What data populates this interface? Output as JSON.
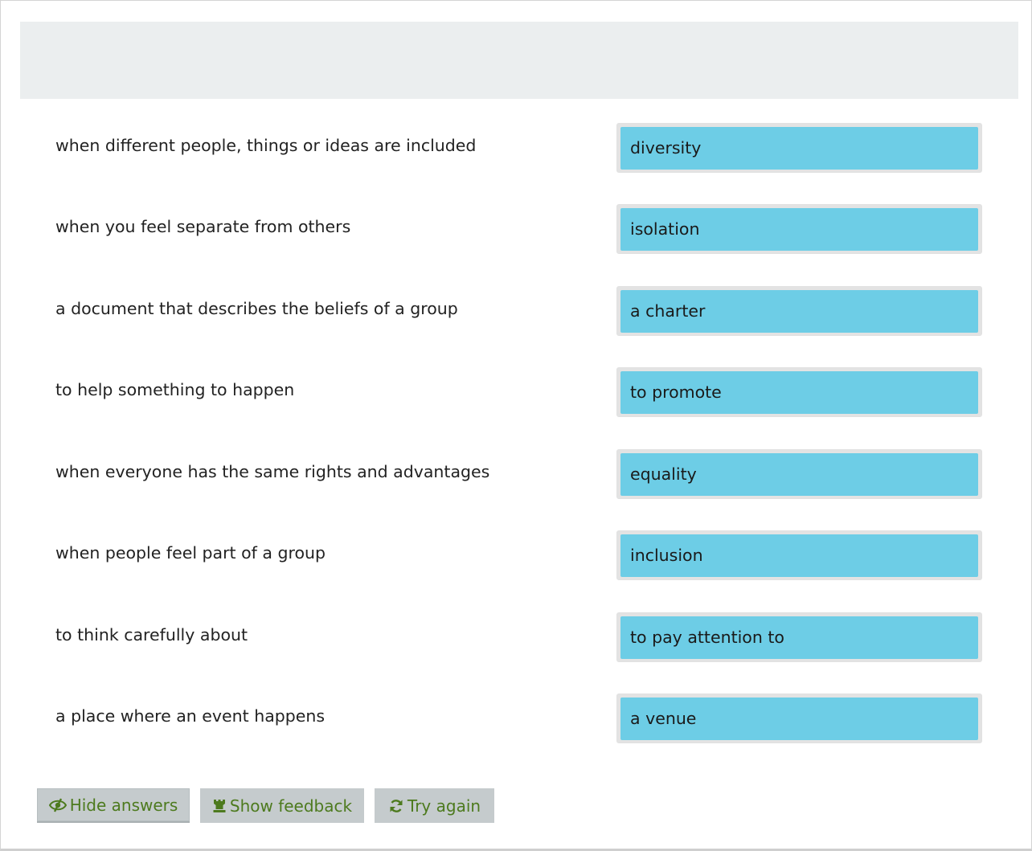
{
  "rows": [
    {
      "prompt": "when different people, things or ideas are included",
      "answer": "diversity"
    },
    {
      "prompt": "when you feel separate from others",
      "answer": "isolation"
    },
    {
      "prompt": "a document that describes the beliefs of a group",
      "answer": "a charter"
    },
    {
      "prompt": "to help something to happen",
      "answer": "to promote"
    },
    {
      "prompt": "when everyone has the same rights and advantages",
      "answer": "equality"
    },
    {
      "prompt": "when people feel part of a group",
      "answer": "inclusion"
    },
    {
      "prompt": "to think carefully about",
      "answer": "to pay attention to"
    },
    {
      "prompt": "a place where an event happens",
      "answer": "a venue"
    }
  ],
  "buttons": {
    "hide_answers": {
      "label": "Hide answers",
      "icon": "eye-slash-icon"
    },
    "show_feedback": {
      "label": "Show feedback",
      "icon": "rook-icon"
    },
    "try_again": {
      "label": "Try again",
      "icon": "refresh-icon"
    }
  },
  "colors": {
    "answer_bg": "#6dcde6",
    "button_bg": "#c5cbcd",
    "button_text": "#4d7a1e",
    "header_bg": "#ebeeef"
  }
}
